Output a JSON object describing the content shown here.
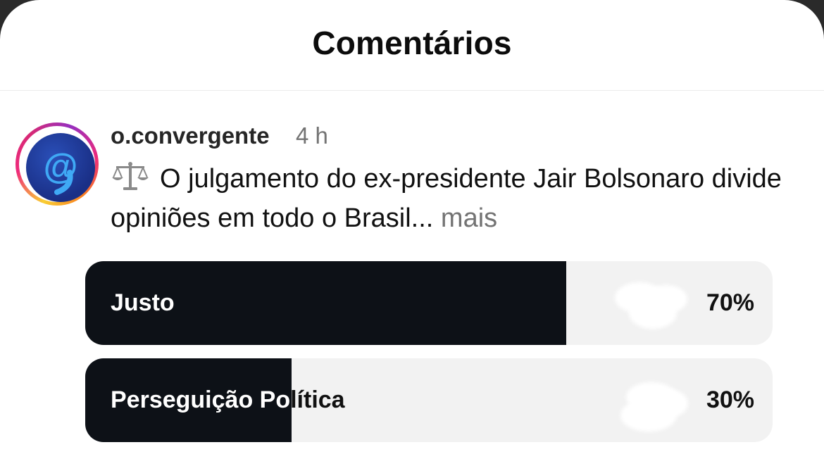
{
  "header": {
    "title": "Comentários"
  },
  "post": {
    "username": "o.convergente",
    "time": "4 h",
    "caption_emoji": "scales-icon",
    "caption_text": "O julgamento do ex-presidente Jair Bolsonaro divide opiniões em todo o Brasil...",
    "more_label": "mais"
  },
  "poll": {
    "options": [
      {
        "label": "Justo",
        "percent_label": "70%",
        "percent": 70
      },
      {
        "label": "Perseguição Política",
        "percent_label": "30%",
        "percent": 30
      }
    ]
  },
  "colors": {
    "fill": "#0d1117",
    "track": "#f2f2f2",
    "muted": "#737373"
  }
}
